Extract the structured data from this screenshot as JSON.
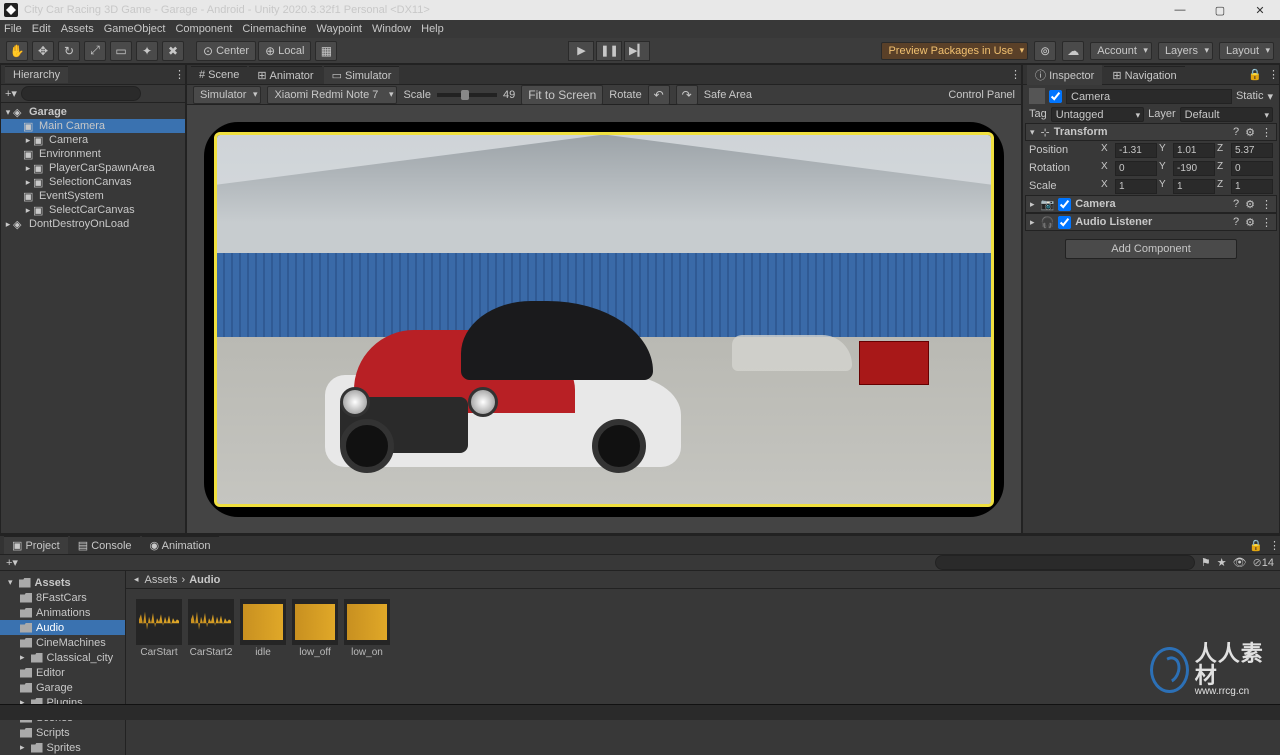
{
  "title": "City Car Racing 3D Game - Garage - Android - Unity 2020.3.32f1 Personal <DX11>",
  "menu": [
    "File",
    "Edit",
    "Assets",
    "GameObject",
    "Component",
    "Cinemachine",
    "Waypoint",
    "Window",
    "Help"
  ],
  "toolbar": {
    "center": "Center",
    "local": "Local",
    "preview": "Preview Packages in Use",
    "account": "Account",
    "layers": "Layers",
    "layout": "Layout"
  },
  "hierarchy": {
    "tab": "Hierarchy",
    "scene": "Garage",
    "items": [
      {
        "label": "Main Camera",
        "selected": true
      },
      {
        "label": "Camera",
        "dim": true
      },
      {
        "label": "Environment"
      },
      {
        "label": "PlayerCarSpawnArea"
      },
      {
        "label": "SelectionCanvas",
        "dim": true
      },
      {
        "label": "EventSystem"
      },
      {
        "label": "SelectCarCanvas"
      }
    ],
    "root2": "DontDestroyOnLoad"
  },
  "scene": {
    "tabs": [
      "Scene",
      "Animator",
      "Simulator"
    ],
    "active_tab": 2,
    "device_dd": "Simulator",
    "device": "Xiaomi Redmi Note 7",
    "scale_label": "Scale",
    "scale_value": "49",
    "fit": "Fit to Screen",
    "rotate": "Rotate",
    "safe": "Safe Area",
    "cp": "Control Panel"
  },
  "inspector": {
    "tabs": [
      "Inspector",
      "Navigation"
    ],
    "name": "Camera",
    "static": "Static",
    "tag_label": "Tag",
    "tag": "Untagged",
    "layer_label": "Layer",
    "layer": "Default",
    "transform": "Transform",
    "position": "Position",
    "rotation": "Rotation",
    "scale": "Scale",
    "pos": {
      "x": "-1.31",
      "y": "1.01",
      "z": "5.37"
    },
    "rot": {
      "x": "0",
      "y": "-190",
      "z": "0"
    },
    "scl": {
      "x": "1",
      "y": "1",
      "z": "1"
    },
    "comp1": "Camera",
    "comp2": "Audio Listener",
    "add": "Add Component"
  },
  "project": {
    "tabs": [
      "Project",
      "Console",
      "Animation"
    ],
    "assets_label": "Assets",
    "folders": [
      "8FastCars",
      "Animations",
      "Audio",
      "CineMachines",
      "Classical_city",
      "Editor",
      "Garage",
      "Plugins",
      "Scenes",
      "Scripts",
      "Sprites"
    ],
    "audio_folder": "Audio",
    "breadcrumb": [
      "Assets",
      "Audio"
    ],
    "assets": [
      "CarStart",
      "CarStart2",
      "idle",
      "low_off",
      "low_on"
    ],
    "count": "14"
  },
  "watermark": {
    "main": "人人素材",
    "sub": "www.rrcg.cn"
  }
}
